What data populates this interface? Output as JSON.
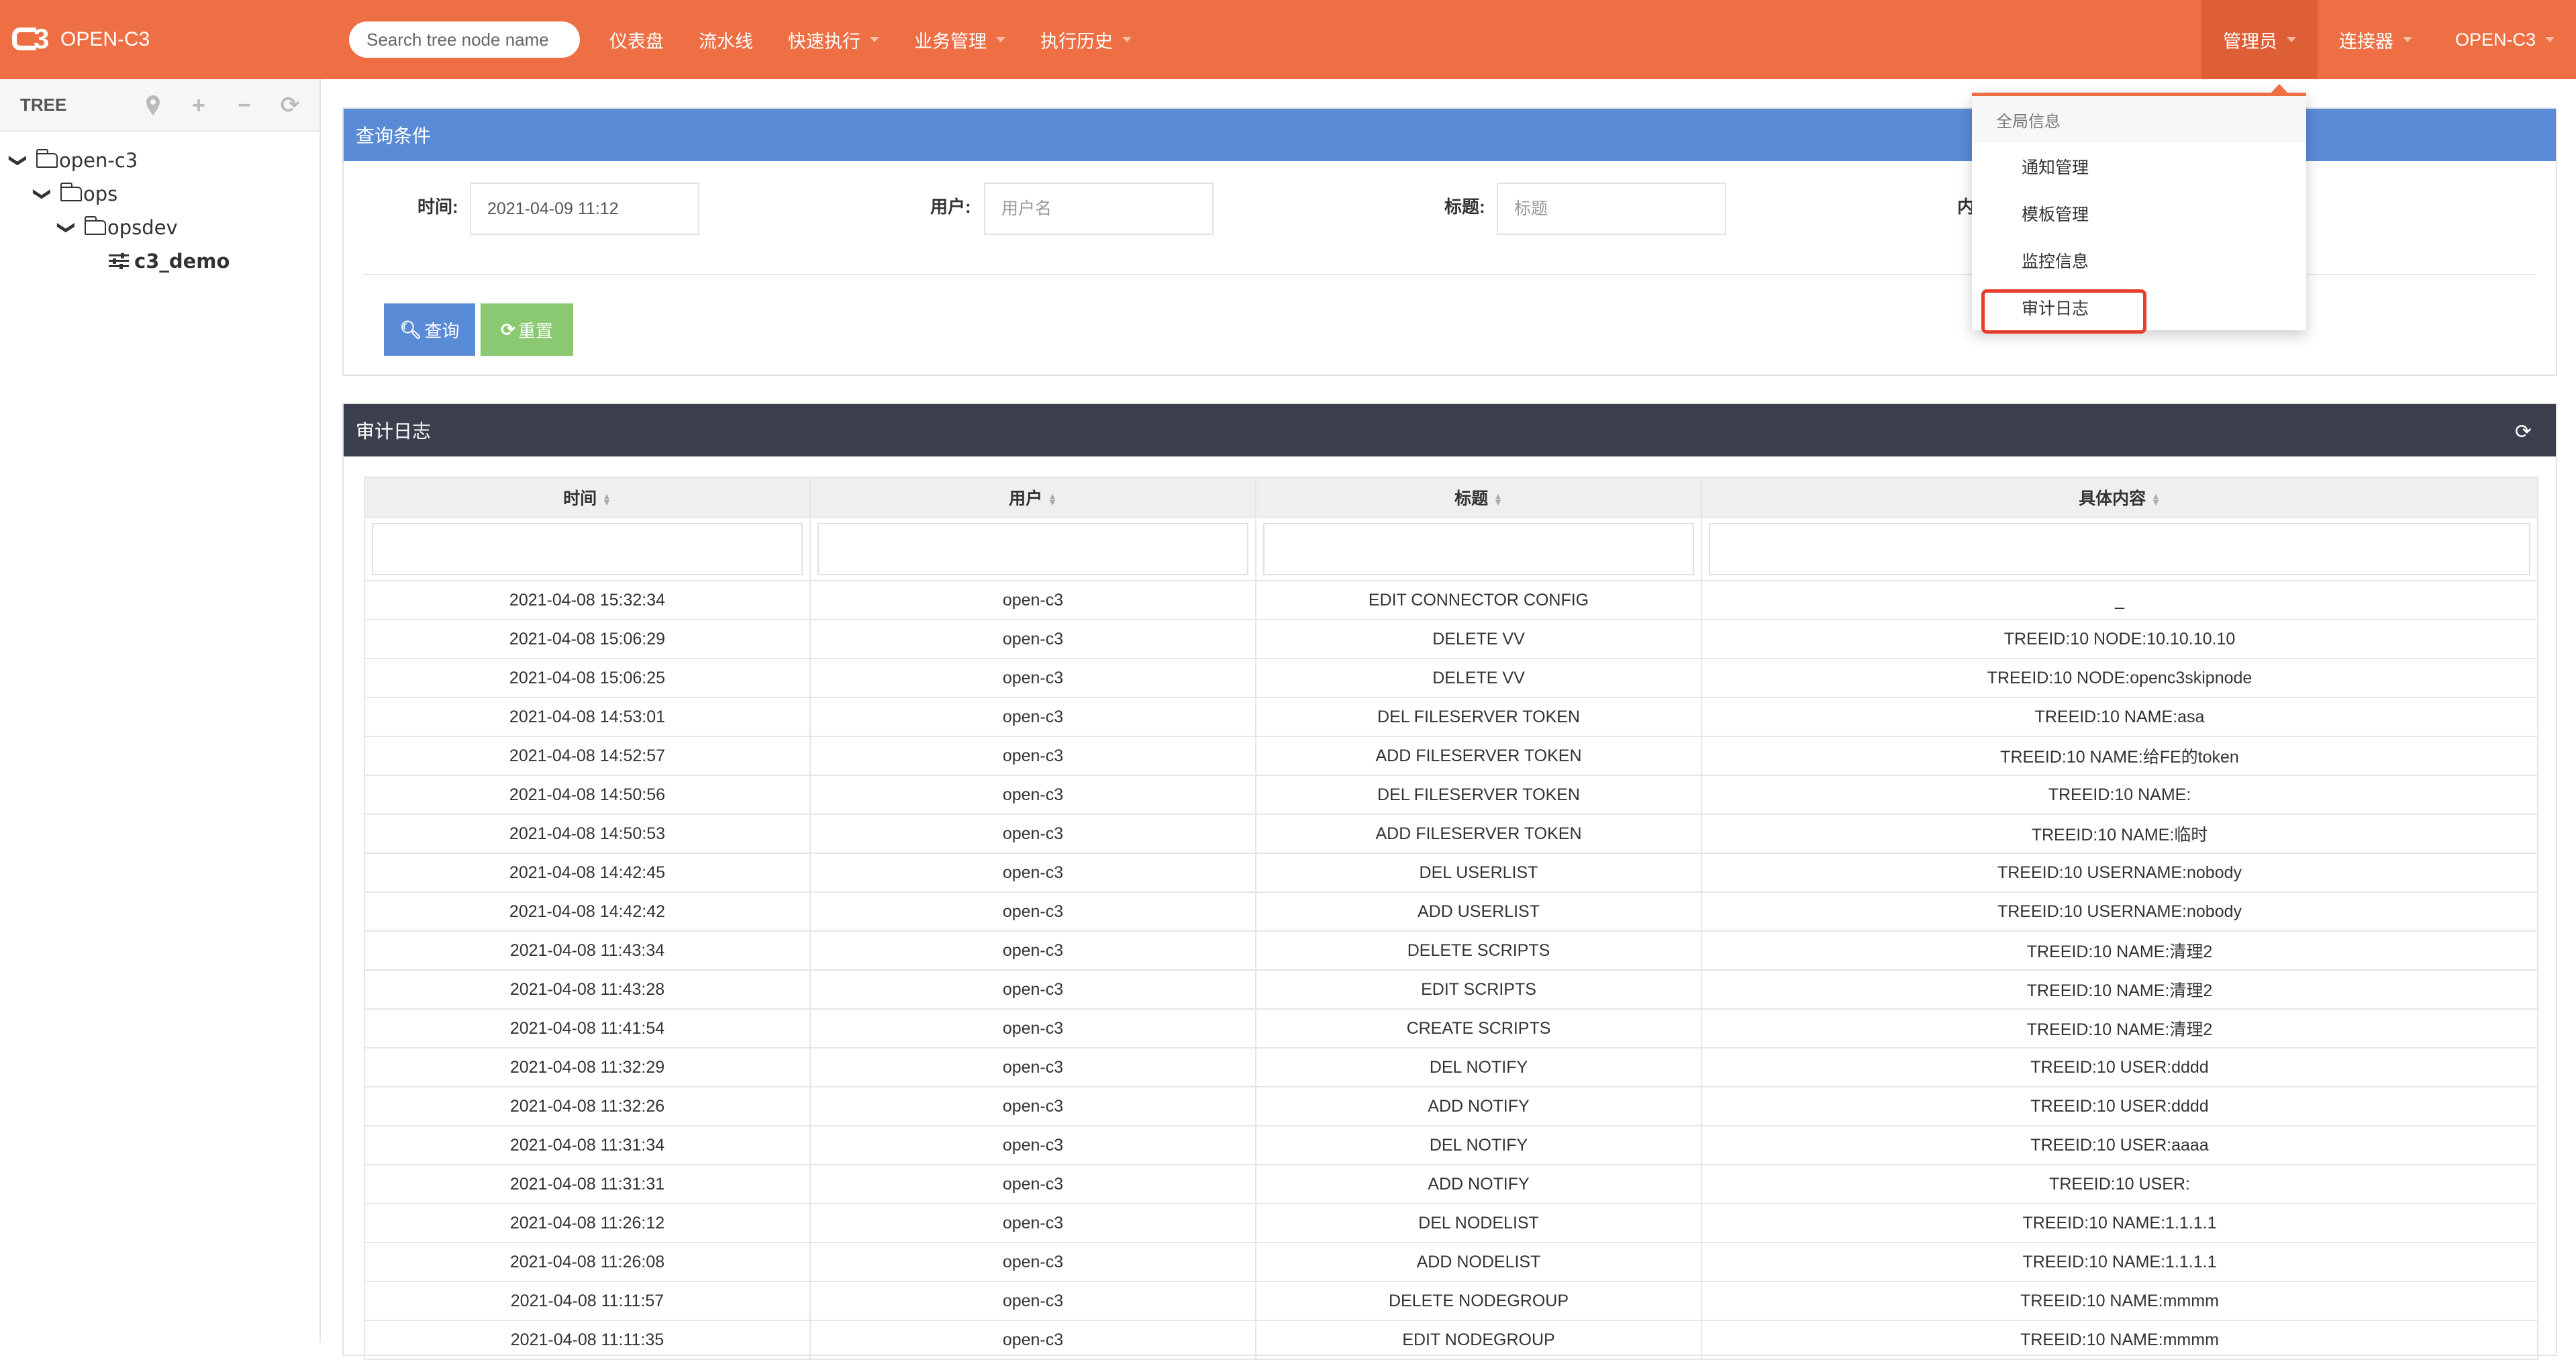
{
  "app": {
    "brand": "OPEN-C3",
    "search_placeholder": "Search tree node name",
    "theme_color": "#EE6F44"
  },
  "nav": {
    "items": [
      {
        "label": "仪表盘",
        "has_caret": false
      },
      {
        "label": "流水线",
        "has_caret": false
      },
      {
        "label": "快速执行",
        "has_caret": true
      },
      {
        "label": "业务管理",
        "has_caret": true
      },
      {
        "label": "执行历史",
        "has_caret": true
      }
    ],
    "right_items": [
      {
        "label": "管理员",
        "active": true
      },
      {
        "label": "连接器",
        "active": false
      },
      {
        "label": "OPEN-C3",
        "active": false
      }
    ]
  },
  "dropdown": {
    "header": "全局信息",
    "items": [
      {
        "label": "通知管理"
      },
      {
        "label": "模板管理"
      },
      {
        "label": "监控信息"
      },
      {
        "label": "审计日志",
        "highlighted": true
      }
    ]
  },
  "sidebar": {
    "title": "TREE",
    "tools": [
      "map-marker-icon",
      "plus-icon",
      "minus-icon",
      "refresh-icon"
    ],
    "nodes": [
      {
        "label": "open-c3",
        "level": 0,
        "type": "folder",
        "expanded": true
      },
      {
        "label": "ops",
        "level": 1,
        "type": "folder",
        "expanded": true
      },
      {
        "label": "opsdev",
        "level": 2,
        "type": "folder",
        "expanded": true
      },
      {
        "label": "c3_demo",
        "level": 3,
        "type": "leaf",
        "selected": true
      }
    ]
  },
  "query": {
    "title": "查询条件",
    "time_label": "时间:",
    "time_value": "2021-04-09 11:12",
    "user_label": "用户:",
    "user_placeholder": "用户名",
    "title_label": "标题:",
    "title_placeholder": "标题",
    "content_label_partial": "内",
    "query_button": "查询",
    "reset_button": "重置"
  },
  "audit": {
    "title": "审计日志",
    "columns": [
      "时间",
      "用户",
      "标题",
      "具体内容"
    ],
    "rows": [
      [
        "2021-04-08 15:32:34",
        "open-c3",
        "EDIT CONNECTOR CONFIG",
        "_"
      ],
      [
        "2021-04-08 15:06:29",
        "open-c3",
        "DELETE VV",
        "TREEID:10 NODE:10.10.10.10"
      ],
      [
        "2021-04-08 15:06:25",
        "open-c3",
        "DELETE VV",
        "TREEID:10 NODE:openc3skipnode"
      ],
      [
        "2021-04-08 14:53:01",
        "open-c3",
        "DEL FILESERVER TOKEN",
        "TREEID:10 NAME:asa"
      ],
      [
        "2021-04-08 14:52:57",
        "open-c3",
        "ADD FILESERVER TOKEN",
        "TREEID:10 NAME:给FE的token"
      ],
      [
        "2021-04-08 14:50:56",
        "open-c3",
        "DEL FILESERVER TOKEN",
        "TREEID:10 NAME:"
      ],
      [
        "2021-04-08 14:50:53",
        "open-c3",
        "ADD FILESERVER TOKEN",
        "TREEID:10 NAME:临时"
      ],
      [
        "2021-04-08 14:42:45",
        "open-c3",
        "DEL USERLIST",
        "TREEID:10 USERNAME:nobody"
      ],
      [
        "2021-04-08 14:42:42",
        "open-c3",
        "ADD USERLIST",
        "TREEID:10 USERNAME:nobody"
      ],
      [
        "2021-04-08 11:43:34",
        "open-c3",
        "DELETE SCRIPTS",
        "TREEID:10 NAME:清理2"
      ],
      [
        "2021-04-08 11:43:28",
        "open-c3",
        "EDIT SCRIPTS",
        "TREEID:10 NAME:清理2"
      ],
      [
        "2021-04-08 11:41:54",
        "open-c3",
        "CREATE SCRIPTS",
        "TREEID:10 NAME:清理2"
      ],
      [
        "2021-04-08 11:32:29",
        "open-c3",
        "DEL NOTIFY",
        "TREEID:10 USER:dddd"
      ],
      [
        "2021-04-08 11:32:26",
        "open-c3",
        "ADD NOTIFY",
        "TREEID:10 USER:dddd"
      ],
      [
        "2021-04-08 11:31:34",
        "open-c3",
        "DEL NOTIFY",
        "TREEID:10 USER:aaaa"
      ],
      [
        "2021-04-08 11:31:31",
        "open-c3",
        "ADD NOTIFY",
        "TREEID:10 USER:"
      ],
      [
        "2021-04-08 11:26:12",
        "open-c3",
        "DEL NODELIST",
        "TREEID:10 NAME:1.1.1.1"
      ],
      [
        "2021-04-08 11:26:08",
        "open-c3",
        "ADD NODELIST",
        "TREEID:10 NAME:1.1.1.1"
      ],
      [
        "2021-04-08 11:11:57",
        "open-c3",
        "DELETE NODEGROUP",
        "TREEID:10 NAME:mmmm"
      ],
      [
        "2021-04-08 11:11:35",
        "open-c3",
        "EDIT NODEGROUP",
        "TREEID:10 NAME:mmmm"
      ]
    ]
  }
}
